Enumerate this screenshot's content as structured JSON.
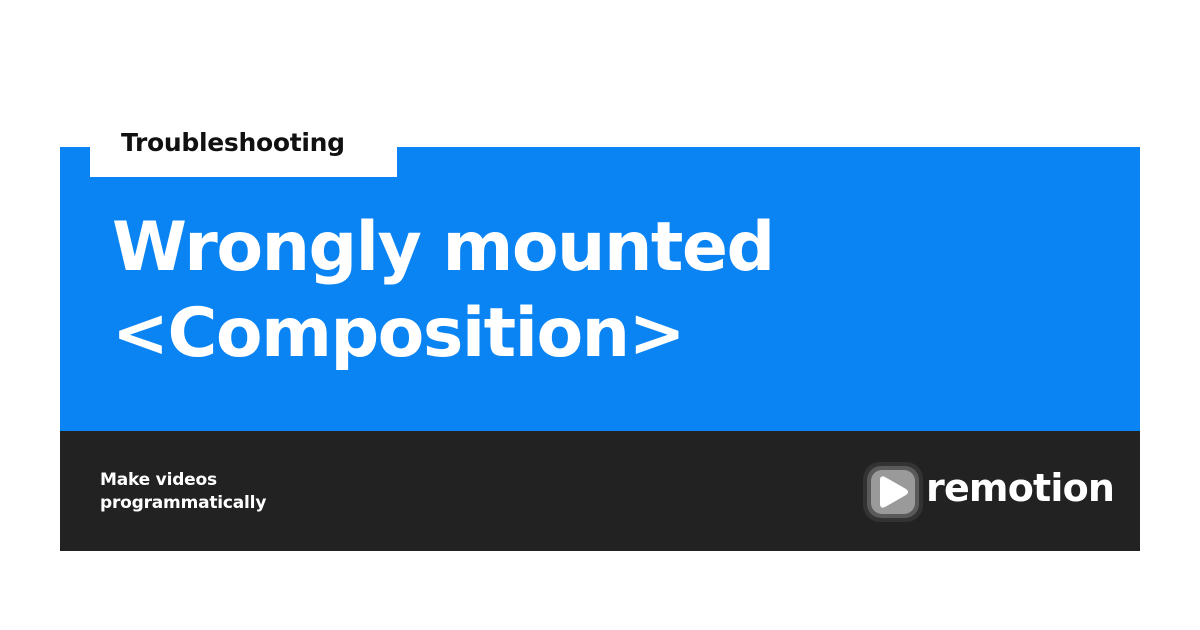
{
  "tag": {
    "label": "Troubleshooting"
  },
  "title": {
    "lines": [
      "Wrongly mounted",
      "<Composition>"
    ]
  },
  "footer": {
    "tagline_lines": [
      "Make videos",
      "programmatically"
    ],
    "logo": {
      "icon": "remotion-play-icon",
      "wordmark": "remotion"
    }
  },
  "colors": {
    "accent": "#0b84f3",
    "footer_bg": "#222222",
    "text_light": "#ffffff",
    "text_dark": "#111111"
  }
}
